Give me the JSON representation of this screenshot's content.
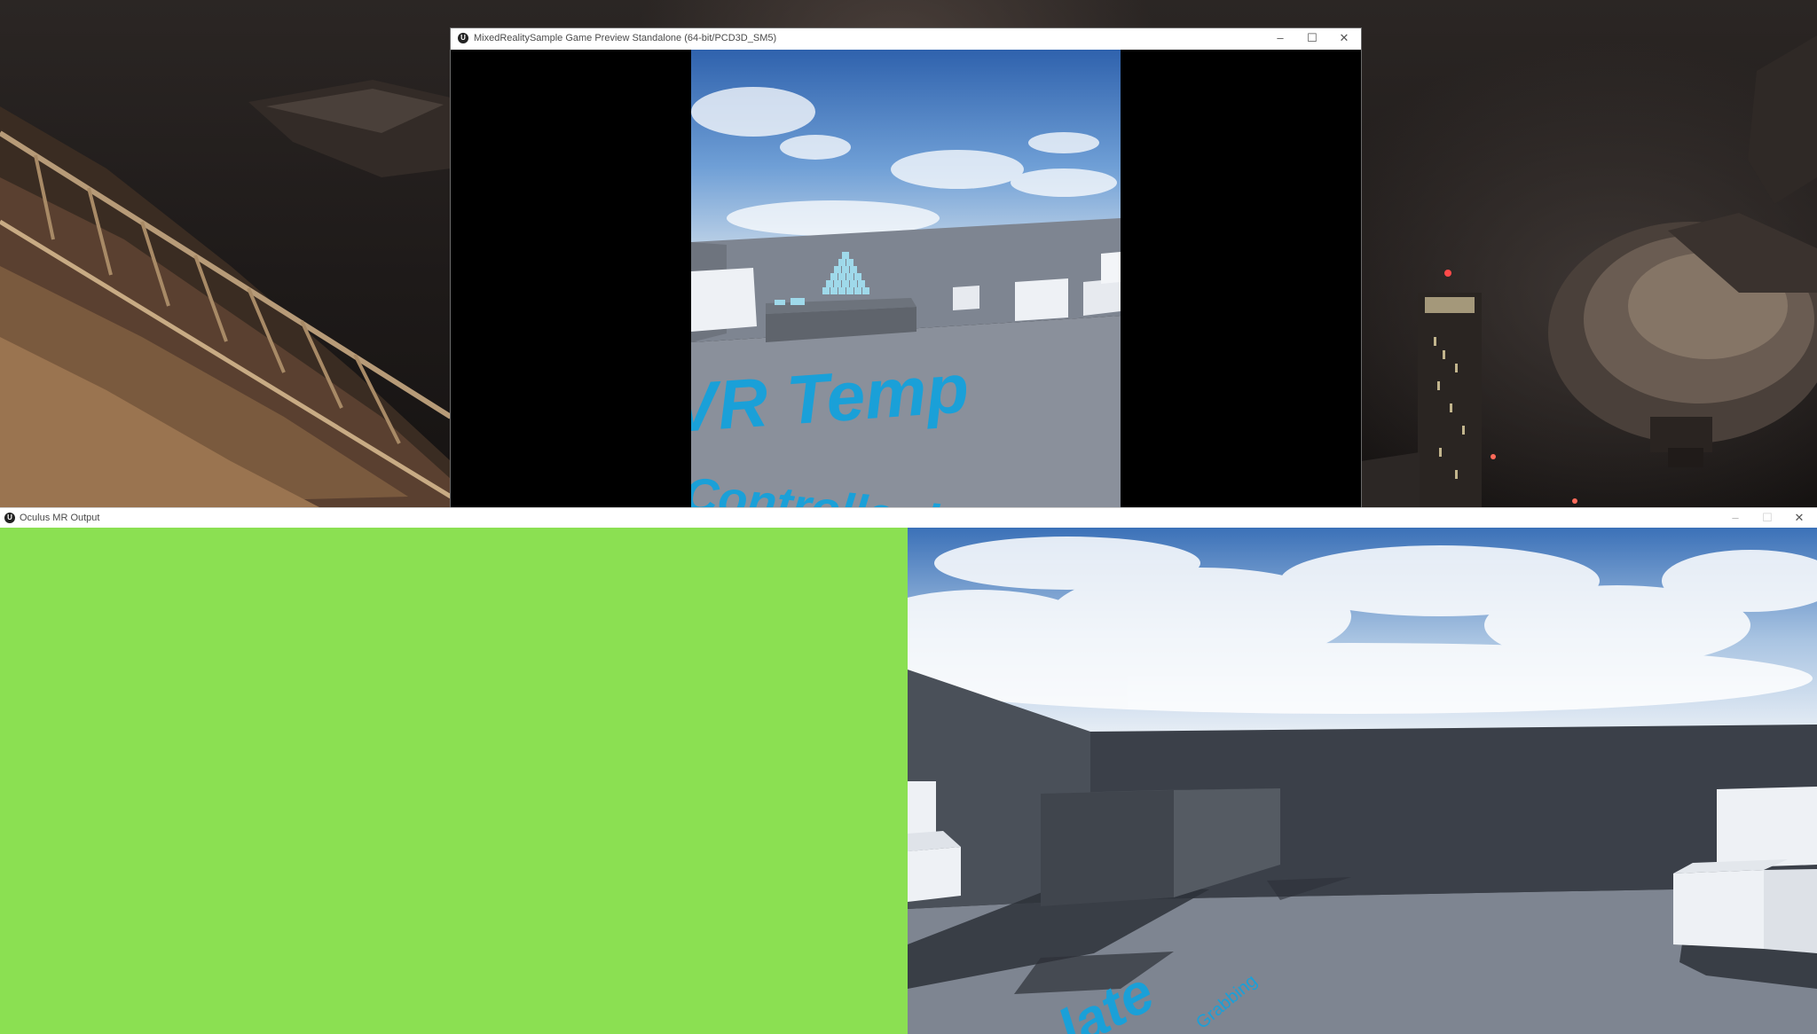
{
  "game_window": {
    "title": "MixedRealitySample Game Preview Standalone (64-bit/PCD3D_SM5)",
    "app_icon": "unreal-engine-logo",
    "controls": {
      "minimize": "–",
      "maximize": "☐",
      "close": "✕"
    },
    "floor_text_line1": "VR Temp",
    "floor_text_line2": "Controller L"
  },
  "mr_window": {
    "title": "Oculus MR Output",
    "app_icon": "unreal-engine-logo",
    "controls": {
      "minimize": "–",
      "maximize": "☐",
      "close": "✕"
    },
    "greenscreen_color": "#8be052",
    "floor_text_line1": "late",
    "floor_text_line2": "Grabbing"
  },
  "colors": {
    "accent_text": "#1aa0d8",
    "floor": "#7e8591",
    "wall": "#3b4049",
    "sky_top": "#3b71b8"
  }
}
